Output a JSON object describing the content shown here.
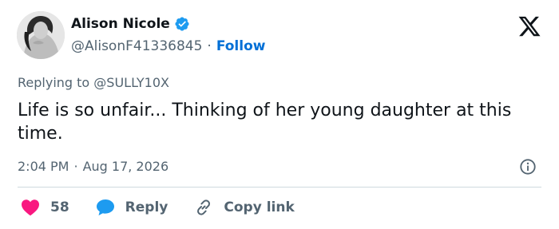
{
  "author": {
    "display_name": "Alison Nicole",
    "handle": "@AlisonF41336845",
    "separator": "·",
    "follow_label": "Follow",
    "verified": true
  },
  "reply_context": "Replying to @SULLY10X",
  "tweet": {
    "text": "Life is so unfair... Thinking of her young daughter at this time."
  },
  "meta": {
    "time": "2:04 PM",
    "separator": "·",
    "date": "Aug 17, 2026"
  },
  "actions": {
    "likes_count": "58",
    "reply_label": "Reply",
    "copy_link_label": "Copy link"
  },
  "icons": {
    "verified": "verified-badge-icon",
    "platform": "x-logo-icon",
    "info": "info-icon",
    "like": "heart-icon",
    "reply": "speech-bubble-icon",
    "copy_link": "link-icon"
  },
  "colors": {
    "text_primary": "#0f1419",
    "text_secondary": "#536471",
    "accent_blue": "#006fd6",
    "verified_blue": "#1d9bf0",
    "like_red": "#f91880",
    "divider": "#cfd9de"
  }
}
